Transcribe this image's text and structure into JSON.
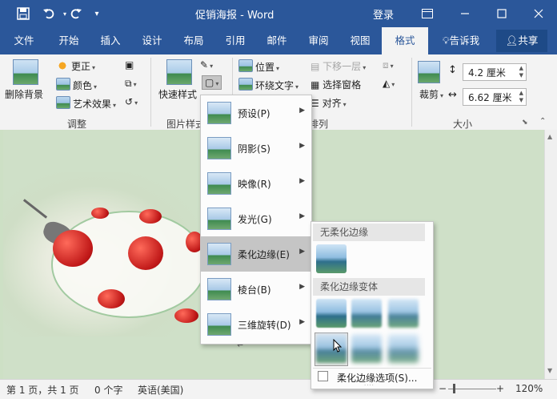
{
  "window": {
    "title": "促销海报 - Word",
    "login": "登录",
    "save_icon": "save-icon",
    "undo_icon": "undo-icon",
    "redo_icon": "redo-icon"
  },
  "tabs": [
    "文件",
    "开始",
    "插入",
    "设计",
    "布局",
    "引用",
    "邮件",
    "审阅",
    "视图",
    "格式"
  ],
  "active_tab": "格式",
  "tell_me": "告诉我",
  "share": "共享",
  "ribbon": {
    "remove_bg": "删除背景",
    "corrections": "更正",
    "color": "颜色",
    "artistic": "艺术效果",
    "group_adjust": "调整",
    "quick_styles": "快速样式",
    "group_picture_styles": "图片样式",
    "position": "位置",
    "wrap_text": "环绕文字",
    "send_backward": "下移一层",
    "selection_pane": "选择窗格",
    "align": "对齐",
    "group_arrange": "排列",
    "crop": "裁剪",
    "height": "4.2 厘米",
    "width": "6.62 厘米",
    "group_size": "大小"
  },
  "effects_menu": [
    {
      "label": "预设(P)"
    },
    {
      "label": "阴影(S)"
    },
    {
      "label": "映像(R)"
    },
    {
      "label": "发光(G)"
    },
    {
      "label": "柔化边缘(E)"
    },
    {
      "label": "棱台(B)"
    },
    {
      "label": "三维旋转(D)"
    }
  ],
  "soft_edges": {
    "no_soft_header": "无柔化边缘",
    "variants_header": "柔化边缘变体",
    "options_label": "柔化边缘选项(S)..."
  },
  "status": {
    "page": "第 1 页，共 1 页",
    "words": "0 个字",
    "language": "英语(美国)",
    "zoom": "120%"
  },
  "colors": {
    "title_bar": "#2b579a",
    "ribbon_bg": "#f3f3f3",
    "doc_bg": "#cfe0c8",
    "menu_hover": "#c5c5c5"
  }
}
